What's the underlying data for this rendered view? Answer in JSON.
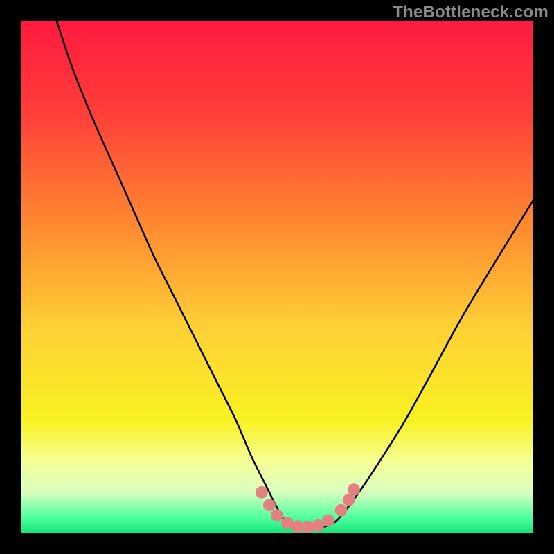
{
  "watermark": "TheBottleneck.com",
  "chart_data": {
    "type": "line",
    "title": "",
    "xlabel": "",
    "ylabel": "",
    "xlim": [
      0,
      100
    ],
    "ylim": [
      0,
      100
    ],
    "gradient_stops": [
      {
        "pct": 0,
        "color": "#ff1a3f"
      },
      {
        "pct": 18,
        "color": "#ff3e3a"
      },
      {
        "pct": 40,
        "color": "#ff8a30"
      },
      {
        "pct": 60,
        "color": "#ffd136"
      },
      {
        "pct": 78,
        "color": "#f8f221"
      },
      {
        "pct": 86,
        "color": "#f6ff96"
      },
      {
        "pct": 92,
        "color": "#d8ffc0"
      },
      {
        "pct": 97,
        "color": "#4eff9e"
      },
      {
        "pct": 100,
        "color": "#14e47a"
      }
    ],
    "series": [
      {
        "name": "bottleneck-curve",
        "color": "#000000",
        "x": [
          7,
          10,
          14,
          18,
          22,
          26,
          30,
          34,
          38,
          42,
          45,
          48,
          50,
          52,
          55,
          58,
          61,
          63,
          66,
          70,
          75,
          80,
          86,
          92,
          100
        ],
        "y": [
          100,
          91,
          81,
          72,
          63,
          54,
          46,
          38,
          30,
          22,
          15,
          9,
          5,
          2,
          1,
          1,
          2,
          4,
          8,
          14,
          22,
          31,
          42,
          52,
          65
        ]
      }
    ],
    "markers": {
      "name": "highlight-dots",
      "color": "#e58080",
      "points": [
        {
          "x": 47,
          "y": 8
        },
        {
          "x": 48.5,
          "y": 5.5
        },
        {
          "x": 50,
          "y": 3.5
        },
        {
          "x": 52,
          "y": 2
        },
        {
          "x": 54,
          "y": 1.3
        },
        {
          "x": 56,
          "y": 1.2
        },
        {
          "x": 58,
          "y": 1.5
        },
        {
          "x": 60,
          "y": 2.5
        },
        {
          "x": 62.5,
          "y": 4.5
        },
        {
          "x": 64,
          "y": 6.5
        },
        {
          "x": 65,
          "y": 8.5
        }
      ]
    }
  }
}
